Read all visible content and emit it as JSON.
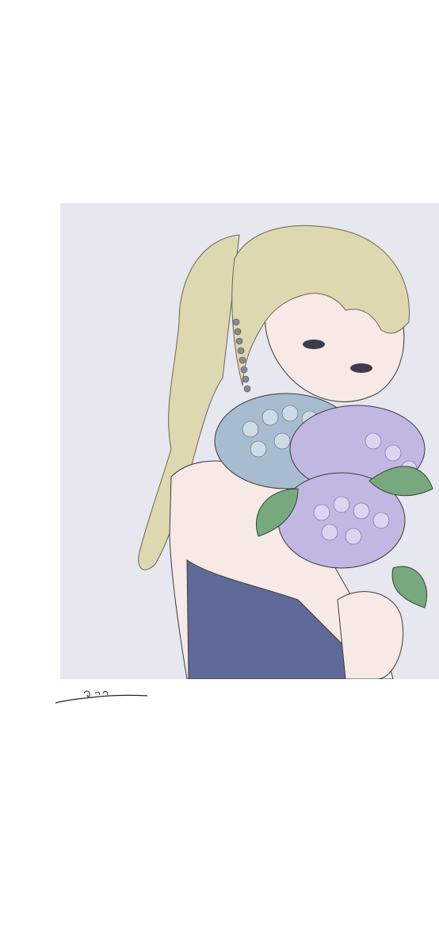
{
  "artwork": {
    "subject": "illustration",
    "colors": {
      "background": "#ffffff",
      "panel": "#e6e7ef",
      "hair": "#ddd8b0",
      "skin": "#f7e9e6",
      "dress": "#606a98",
      "hydrangea_blue": "#a8bcd0",
      "hydrangea_lavender": "#c2b7e2",
      "leaf": "#78a87e",
      "line": "#3a3a3a"
    },
    "signature_present": true
  }
}
